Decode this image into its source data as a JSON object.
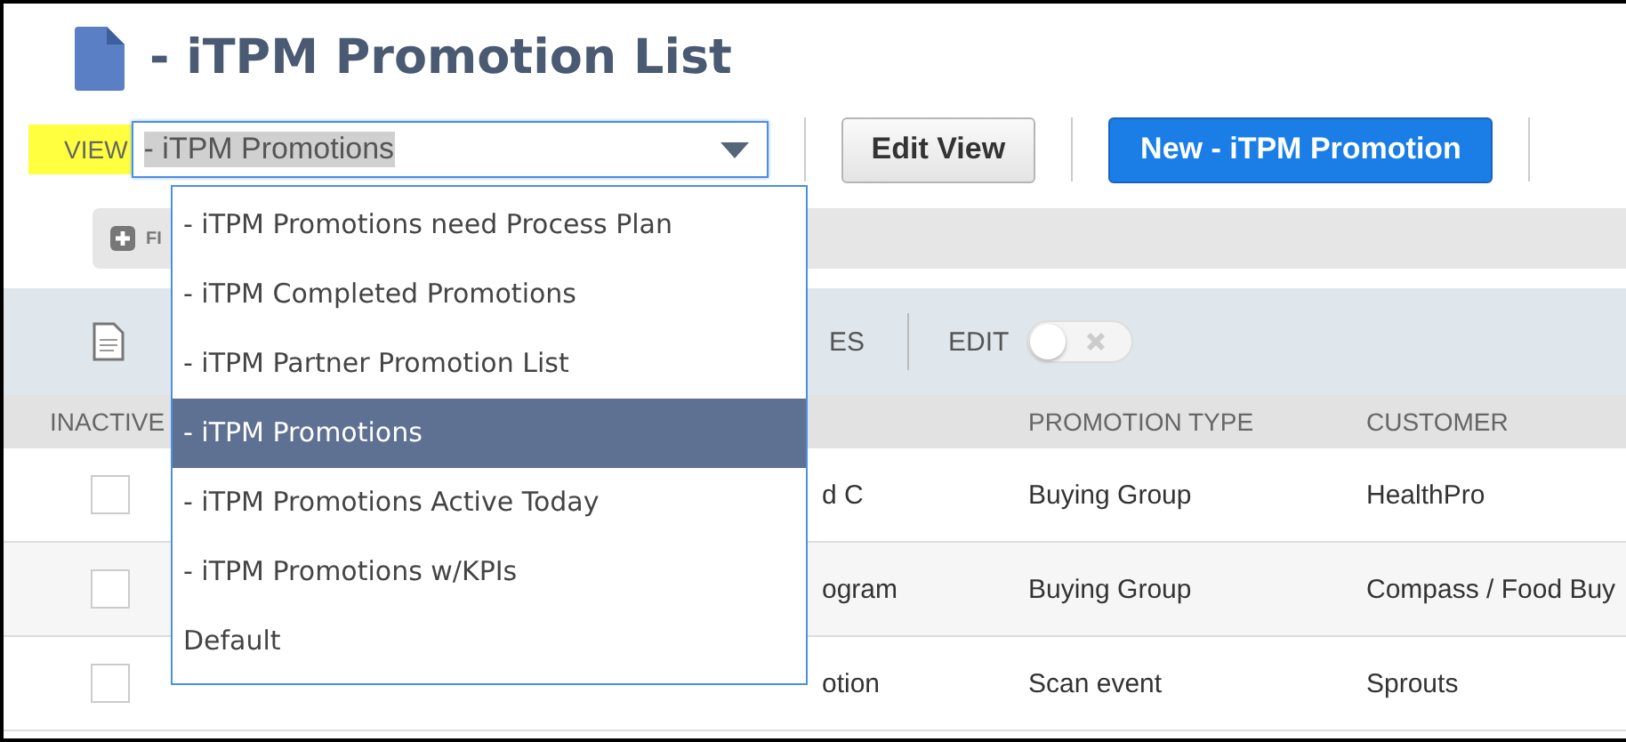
{
  "page": {
    "title": "- iTPM Promotion List"
  },
  "view": {
    "label": "VIEW",
    "value": "- iTPM Promotions",
    "expanded": true,
    "options": [
      {
        "label": "- iTPM Promotions need Process Plan",
        "selected": false
      },
      {
        "label": "- iTPM Completed Promotions",
        "selected": false
      },
      {
        "label": "- iTPM Partner Promotion List",
        "selected": false
      },
      {
        "label": "- iTPM Promotions",
        "selected": true
      },
      {
        "label": "- iTPM Promotions Active Today",
        "selected": false
      },
      {
        "label": "- iTPM Promotions w/KPIs",
        "selected": false
      },
      {
        "label": "Default",
        "selected": false
      }
    ]
  },
  "buttons": [
    {
      "label": "Edit View",
      "kind": "secondary"
    },
    {
      "label": "New - iTPM Promotion",
      "kind": "primary"
    }
  ],
  "filter_bar": {
    "label": "FI"
  },
  "toolbar": {
    "label": "ES",
    "edit": {
      "label": "EDIT",
      "on": false
    }
  },
  "table": {
    "columns": [
      "INACTIVE",
      "PROMOTION TYPE",
      "CUSTOMER"
    ],
    "rows": [
      {
        "inactive": false,
        "column_3": "d C",
        "promotion_type": "Buying Group",
        "customer": "HealthPro"
      },
      {
        "inactive": false,
        "column_3": "ogram",
        "promotion_type": "Buying Group",
        "customer": "Compass / Food Buy"
      },
      {
        "inactive": false,
        "column_3": "otion",
        "promotion_type": "Scan event",
        "customer": "Sprouts"
      }
    ]
  }
}
